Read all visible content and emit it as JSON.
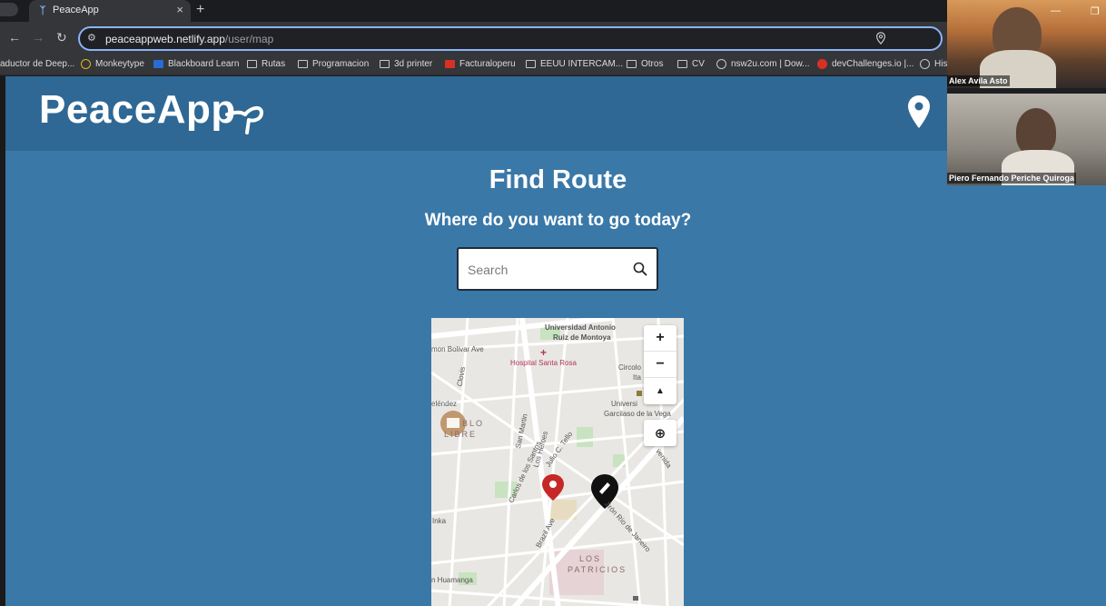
{
  "browser": {
    "tab_title": "PeaceApp",
    "new_tab_label": "+",
    "close_label": "×",
    "url_host": "peaceappweb.netlify.app",
    "url_path": "/user/map",
    "nav": {
      "back": "←",
      "forward": "→",
      "reload": "↻"
    },
    "bookmarks": [
      "aductor de Deep...",
      "Monkeytype",
      "Blackboard Learn",
      "Rutas",
      "Programacion",
      "3d printer",
      "Facturaloperu",
      "EEUU INTERCAM...",
      "Otros",
      "CV",
      "nsw2u.com | Dow...",
      "devChallenges.io |...",
      "His"
    ]
  },
  "app": {
    "logo_text": "PeaceApp",
    "title": "Find Route",
    "subtitle": "Where do you want to go today?",
    "search": {
      "placeholder": "Search",
      "value": ""
    }
  },
  "map": {
    "labels": {
      "bolivar": "mon Bolivar Ave",
      "universidad_antonio": "Universidad Antonio",
      "ruiz": "Ruiz de Montoya",
      "hospital": "Hospital Santa Rosa",
      "circolo": "Circolo",
      "ita": "Ita",
      "unive": "Universi",
      "garcilaso": "Garcilaso de la Vega",
      "elendez": "eléndez",
      "pueblo": "BLO",
      "libre": "LIBRE",
      "san_martin": "San Martin",
      "los_heroes": "Los Heroes",
      "julio_c_tello": "Julio C. Tello",
      "carlos_santos": "Carlos de los Santos",
      "brazil": "Brazil Ave",
      "jiron_rio": "Jirón Río de Janeiro",
      "inka": "Inka",
      "los": "LOS",
      "patricios": "PATRICIOS",
      "huamanga": "n Huamanga",
      "avenida": "venida",
      "cloves": "Clovis"
    },
    "controls": {
      "zoom_in": "+",
      "zoom_out": "−",
      "compass": "▲",
      "locate": "⊕"
    }
  },
  "video_call": {
    "participants": [
      {
        "name": "Alex Avila Asto"
      },
      {
        "name": "Piero Fernando Periche Quiroga"
      }
    ],
    "minimize": "—",
    "restore": "❐"
  },
  "colors": {
    "page_bg": "#3a78a8",
    "header_bg": "#2f6894",
    "pin_red": "#c62828"
  }
}
